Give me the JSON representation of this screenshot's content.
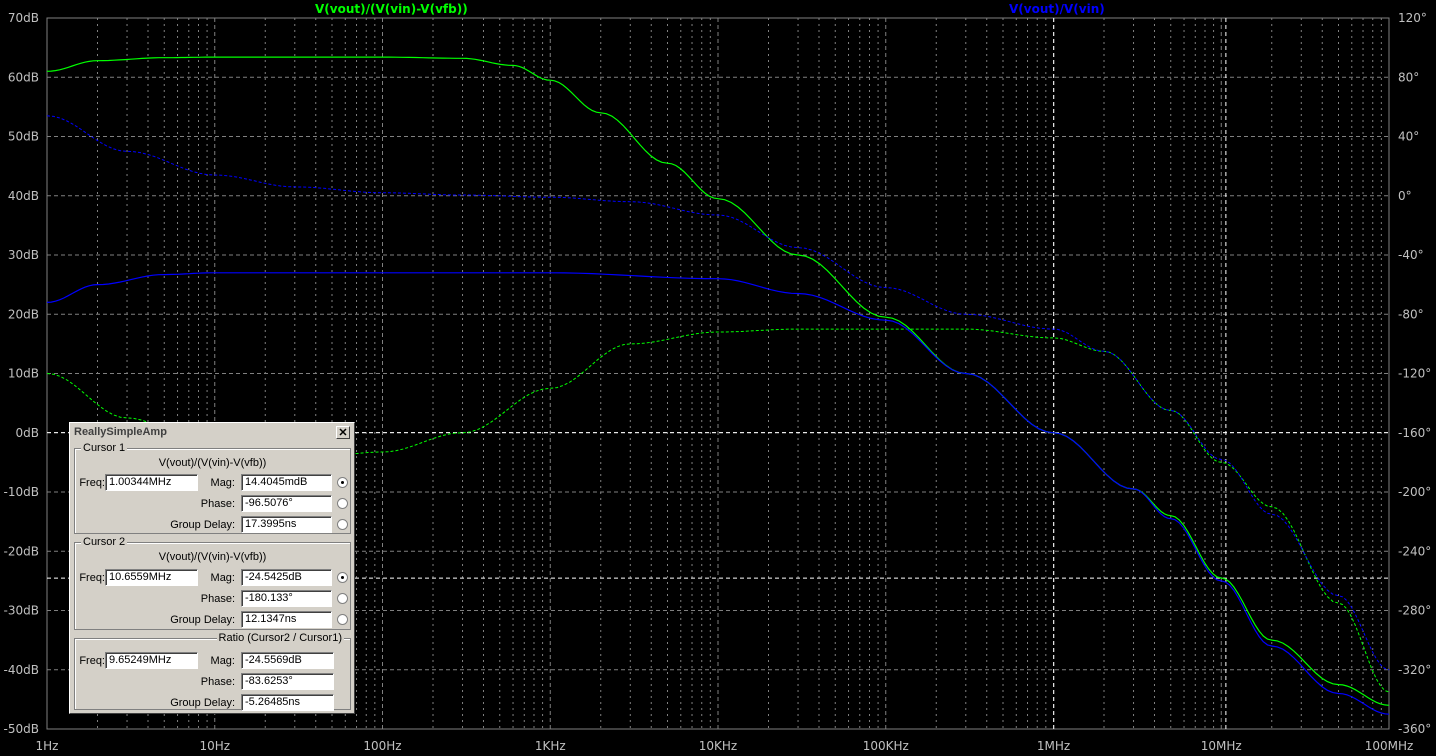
{
  "traces": {
    "t1": {
      "name": "V(vout)/(V(vin)-V(vfb))",
      "color": "#00ff00"
    },
    "t2": {
      "name": "V(vout)/V(vin)",
      "color": "#0000ff"
    }
  },
  "chart_data": {
    "type": "line",
    "x_scale": "log",
    "xlim": [
      "1Hz",
      "100MHz"
    ],
    "x_ticks": [
      "1Hz",
      "10Hz",
      "100Hz",
      "1KHz",
      "10KHz",
      "100KHz",
      "1MHz",
      "10MHz",
      "100MHz"
    ],
    "ylim_left": [
      -50,
      70
    ],
    "y_ticks_left": [
      "70dB",
      "60dB",
      "50dB",
      "40dB",
      "30dB",
      "20dB",
      "10dB",
      "0dB",
      "-10dB",
      "-20dB",
      "-30dB",
      "-40dB",
      "-50dB"
    ],
    "ylim_right": [
      -360,
      120
    ],
    "y_ticks_right": [
      "120°",
      "80°",
      "40°",
      "0°",
      "-40°",
      "-80°",
      "-120°",
      "-160°",
      "-200°",
      "-240°",
      "-280°",
      "-320°",
      "-360°"
    ],
    "grid": true,
    "series": [
      {
        "name": "V(vout)/(V(vin)-V(vfb))",
        "quantity": "magnitude_dB",
        "x": [
          1,
          2,
          5,
          10,
          30,
          100,
          300,
          600,
          1000,
          2000,
          5000,
          10000,
          30000,
          100000,
          300000,
          1000000,
          3000000,
          5000000,
          10000000,
          20000000,
          50000000,
          100000000
        ],
        "y": [
          61,
          62.8,
          63.3,
          63.4,
          63.4,
          63.4,
          63.2,
          62,
          59.5,
          54,
          45.5,
          39.5,
          30,
          19.5,
          10,
          0,
          -9.5,
          -14,
          -24.5,
          -35,
          -42.5,
          -46
        ]
      },
      {
        "name": "V(vout)/(V(vin)-V(vfb))",
        "quantity": "phase_deg",
        "x": [
          1,
          3,
          10,
          30,
          100,
          300,
          1000,
          3000,
          10000,
          30000,
          100000,
          300000,
          1000000,
          2000000,
          5000000,
          10000000,
          20000000,
          50000000,
          100000000
        ],
        "y": [
          -120,
          -150,
          -172,
          -178,
          -173,
          -160,
          -130,
          -100,
          -92,
          -90,
          -90,
          -90,
          -96,
          -105,
          -145,
          -180,
          -210,
          -275,
          -335
        ]
      },
      {
        "name": "V(vout)/V(vin)",
        "quantity": "magnitude_dB",
        "x": [
          1,
          2,
          5,
          10,
          30,
          100,
          1000,
          10000,
          30000,
          100000,
          300000,
          1000000,
          3000000,
          5000000,
          10000000,
          20000000,
          50000000,
          100000000
        ],
        "y": [
          22,
          25,
          26.7,
          27,
          27,
          27,
          27,
          26,
          23.5,
          19,
          10,
          0,
          -9.5,
          -14.5,
          -25,
          -36,
          -44,
          -47.5
        ]
      },
      {
        "name": "V(vout)/V(vin)",
        "quantity": "phase_deg",
        "x": [
          1,
          3,
          10,
          30,
          100,
          300,
          1000,
          3000,
          10000,
          30000,
          100000,
          300000,
          1000000,
          2000000,
          5000000,
          10000000,
          20000000,
          50000000,
          100000000
        ],
        "y": [
          54,
          30,
          14,
          6,
          2,
          0.5,
          -1,
          -4,
          -13,
          -35,
          -62,
          -80,
          -90,
          -105,
          -145,
          -178,
          -215,
          -270,
          -320
        ]
      }
    ],
    "cursors": {
      "vertical": [
        "1.00344MHz",
        "10.6559MHz"
      ],
      "horizontal": [
        "14.4045mdB",
        "-24.5425dB"
      ]
    }
  },
  "dialog": {
    "title": "ReallySimpleAmp",
    "close": "✕",
    "cursor1": {
      "legend": "Cursor 1",
      "expr": "V(vout)/(V(vin)-V(vfb))",
      "freq_label": "Freq:",
      "freq": "1.00344MHz",
      "mag_label": "Mag:",
      "mag": "14.4045mdB",
      "phase_label": "Phase:",
      "phase": "-96.5076°",
      "gd_label": "Group Delay:",
      "gd": "17.3995ns"
    },
    "cursor2": {
      "legend": "Cursor 2",
      "expr": "V(vout)/(V(vin)-V(vfb))",
      "freq_label": "Freq:",
      "freq": "10.6559MHz",
      "mag_label": "Mag:",
      "mag": "-24.5425dB",
      "phase_label": "Phase:",
      "phase": "-180.133°",
      "gd_label": "Group Delay:",
      "gd": "12.1347ns"
    },
    "ratio": {
      "legend": "Ratio (Cursor2 / Cursor1)",
      "freq_label": "Freq:",
      "freq": "9.65249MHz",
      "mag_label": "Mag:",
      "mag": "-24.5569dB",
      "phase_label": "Phase:",
      "phase": "-83.6253°",
      "gd_label": "Group Delay:",
      "gd": "-5.26485ns"
    }
  }
}
